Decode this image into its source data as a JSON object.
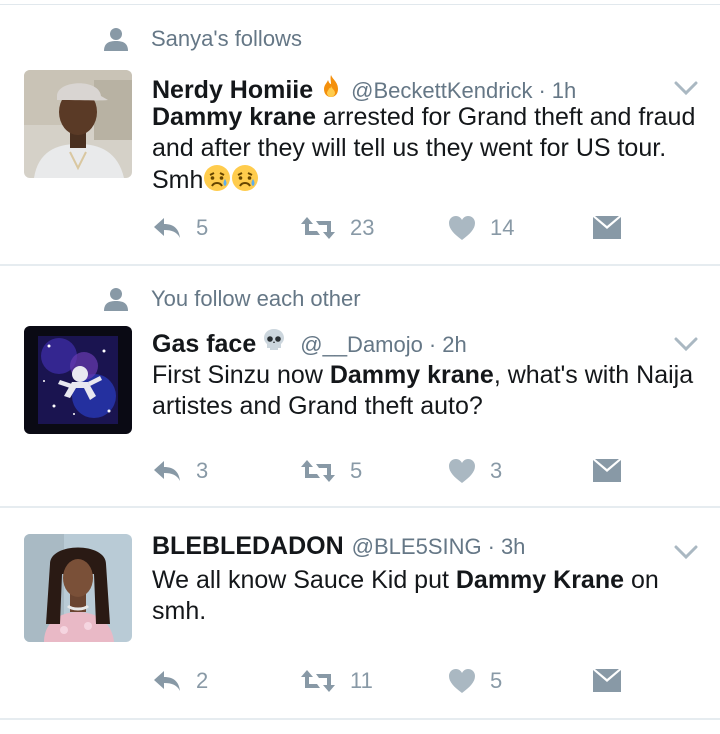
{
  "tweets": [
    {
      "context": "Sanya's follows",
      "name": "Nerdy Homiie",
      "name_emoji": "fire-icon",
      "handle": "@BeckettKendrick",
      "sep": "·",
      "time": "1h",
      "text_bold": "Dammy krane",
      "text_rest": " arrested for Grand theft and fraud and after they will tell us they went for US tour. Smh",
      "text_emojis": [
        "disappointed-relieved-face-icon",
        "disappointed-relieved-face-icon"
      ],
      "replies": "5",
      "retweets": "23",
      "likes": "14"
    },
    {
      "context": "You follow each other",
      "name": "Gas face",
      "name_emoji": "skull-icon",
      "handle": "@__Damojo",
      "sep": "·",
      "time": "2h",
      "text_pre": "First Sinzu now ",
      "text_bold": "Dammy krane",
      "text_rest": ", what's with Naija artistes and Grand theft auto?",
      "replies": "3",
      "retweets": "5",
      "likes": "3"
    },
    {
      "name": "BLEBLEDADON",
      "handle": "@BLE5SING",
      "sep": "·",
      "time": "3h",
      "text_pre": "We all know Sauce Kid put ",
      "text_bold": "Dammy Krane",
      "text_rest": " on smh.",
      "replies": "2",
      "retweets": "11",
      "likes": "5"
    }
  ],
  "colors": {
    "name": "#14171a",
    "muted": "#657786",
    "icon": "#8899a6",
    "divider": "#e6ecf0"
  }
}
